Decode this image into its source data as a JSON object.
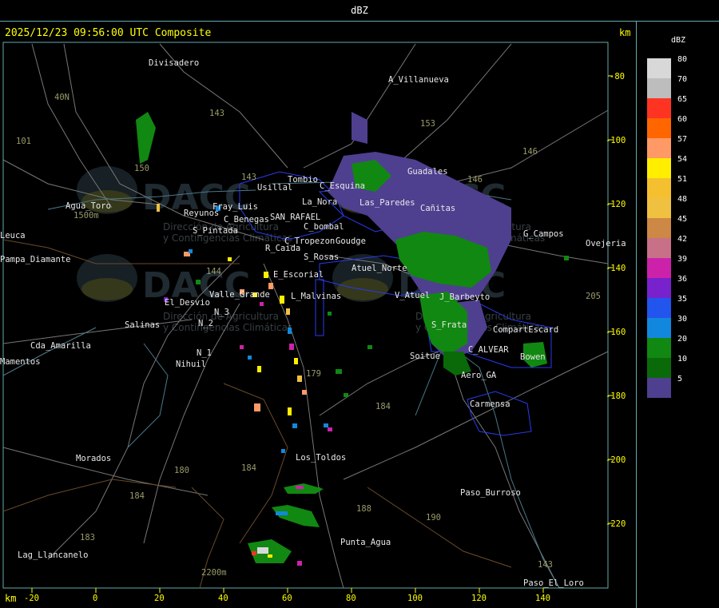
{
  "window": {
    "title": "dBZ"
  },
  "header": {
    "timestamp": "2025/12/23 09:56:00 UTC Composite",
    "km_label": "km"
  },
  "axes": {
    "y_ticks": [
      "-80",
      "-100",
      "-120",
      "-140",
      "-160",
      "-180",
      "-200",
      "-220"
    ],
    "x_ticks": [
      "-20",
      "0",
      "20",
      "40",
      "60",
      "80",
      "100",
      "120",
      "140"
    ],
    "x_unit": "km"
  },
  "legend": {
    "title": "dBZ",
    "entries": [
      {
        "label": "80",
        "color": "#d8d8d8"
      },
      {
        "label": "70",
        "color": "#bdbdbd"
      },
      {
        "label": "65",
        "color": "#ff3322"
      },
      {
        "label": "60",
        "color": "#ff6600"
      },
      {
        "label": "57",
        "color": "#ff9966"
      },
      {
        "label": "54",
        "color": "#ffee00"
      },
      {
        "label": "51",
        "color": "#f5c030"
      },
      {
        "label": "48",
        "color": "#f0c040"
      },
      {
        "label": "45",
        "color": "#cc8844"
      },
      {
        "label": "42",
        "color": "#c87088"
      },
      {
        "label": "39",
        "color": "#cc22aa"
      },
      {
        "label": "36",
        "color": "#7722cc"
      },
      {
        "label": "35",
        "color": "#2255ee"
      },
      {
        "label": "30",
        "color": "#1188dd"
      },
      {
        "label": "20",
        "color": "#118811"
      },
      {
        "label": "10",
        "color": "#0a6a0a"
      },
      {
        "label": "5",
        "color": "#4f3f8f"
      }
    ]
  },
  "places": [
    "Divisadero",
    "A_Villanueva",
    "Guadales",
    "Usillal",
    "Tombio",
    "C_Esquina",
    "La_Nora",
    "Las_Paredes",
    "Cañitas",
    "Reyunos",
    "Fray_Luis",
    "Pampa_Diamante",
    "Agua_Toro",
    "S_Pintada",
    "C_Benegas",
    "SAN_RAFAEL",
    "C_bombal",
    "Goudge",
    "C_Tropezon",
    "R_Caida",
    "S_Rosas",
    "Atuel_Norte",
    "G_Campos",
    "Ovejeria",
    "E_Escorial",
    "Valle_Grande",
    "L_Malvinas",
    "V_Atuel",
    "J_Barbeyto",
    "El_Desvio",
    "N_2",
    "N_3",
    "Salinas",
    "S_Frata",
    "CompartEscard",
    "C_ALVEAR",
    "Bowen",
    "Cda_Amarilla",
    "Mamentos",
    "Nihuil",
    "N_1",
    "Soitue",
    "Aero_GA",
    "Carmensa",
    "Morados",
    "Los_Toldos",
    "Paso_Burroso",
    "Punta_Agua",
    "Lag_Llancanelo",
    "Paso_El_Loro",
    "Leuca"
  ],
  "road_numbers": [
    "143",
    "153",
    "146",
    "101",
    "40N",
    "146",
    "150",
    "143",
    "144",
    "188",
    "184",
    "179",
    "184",
    "180",
    "184",
    "183",
    "190",
    "143",
    "205"
  ],
  "elevations": [
    "1500m",
    "2200m"
  ],
  "watermark": {
    "text": "DACC",
    "subtitle_1": "Dirección de Agricultura",
    "subtitle_2": "y Contingencias Climáticas"
  }
}
